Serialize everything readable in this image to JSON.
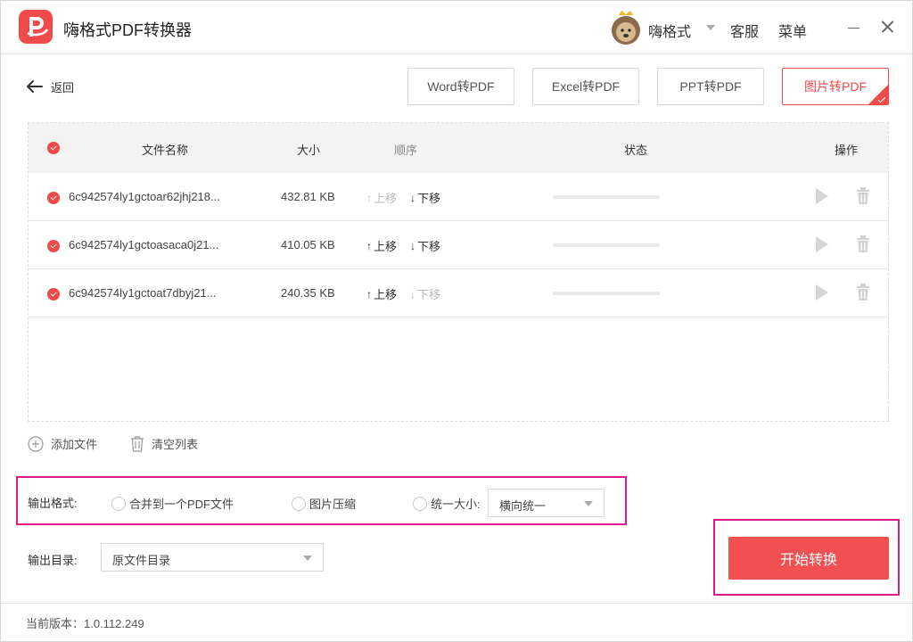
{
  "app": {
    "title": "嗨格式PDF转换器"
  },
  "titlebar": {
    "username": "嗨格式",
    "service": "客服",
    "menu": "菜单"
  },
  "nav": {
    "back": "返回"
  },
  "tabs": [
    {
      "label": "Word转PDF",
      "active": false
    },
    {
      "label": "Excel转PDF",
      "active": false
    },
    {
      "label": "PPT转PDF",
      "active": false
    },
    {
      "label": "图片转PDF",
      "active": true
    }
  ],
  "table": {
    "headers": {
      "name": "文件名称",
      "size": "大小",
      "order": "顺序",
      "status": "状态",
      "action": "操作"
    },
    "move_up": "上移",
    "move_down": "下移",
    "rows": [
      {
        "name": "6c942574ly1gctoar62jhj218...",
        "size": "432.81 KB",
        "up_enabled": false,
        "down_enabled": true,
        "progress": 0
      },
      {
        "name": "6c942574ly1gctoasaca0j21...",
        "size": "410.05 KB",
        "up_enabled": true,
        "down_enabled": true,
        "progress": 0
      },
      {
        "name": "6c942574ly1gctoat7dbyj21...",
        "size": "240.35 KB",
        "up_enabled": true,
        "down_enabled": false,
        "progress": 0
      }
    ]
  },
  "actions": {
    "add_file": "添加文件",
    "clear_list": "清空列表"
  },
  "output_format": {
    "label": "输出格式:",
    "options": [
      "合并到一个PDF文件",
      "图片压缩",
      "统一大小:"
    ],
    "size_select": "横向统一"
  },
  "output_dir": {
    "label": "输出目录:",
    "value": "原文件目录"
  },
  "start": {
    "label": "开始转换"
  },
  "footer": {
    "version": "当前版本：1.0.112.249"
  },
  "colors": {
    "accent": "#f04a4a",
    "highlight": "#e0188a"
  }
}
